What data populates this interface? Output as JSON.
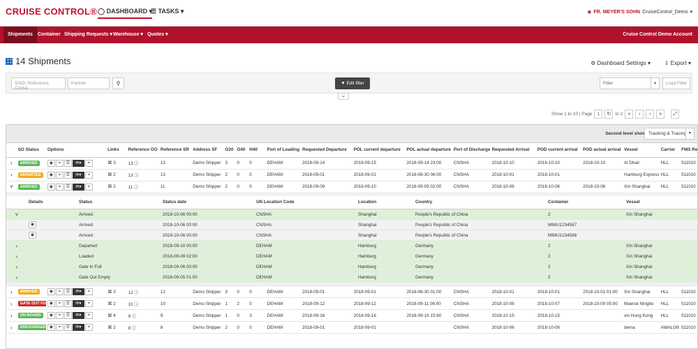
{
  "app": {
    "title": "CRUISE CONTROL®",
    "brand": "FR. MEYER'S SOHN",
    "user": "CruiseControl_Demo",
    "nav_dashboard": "DASHBOARD",
    "nav_tasks": "TASKS"
  },
  "menu": {
    "items": [
      "Shipments",
      "Container",
      "Shipping Requests",
      "Warehouse",
      "Quotes"
    ],
    "account": "Cruise Control Demo Account"
  },
  "page": {
    "title": "14 Shipments",
    "settings": "Dashboard Settings",
    "export": "Export"
  },
  "filters": {
    "search_placeholder": "SSID, Reference, Contai",
    "partner_placeholder": "Partner",
    "edit_filter": "Edit filter",
    "filter_select": "Filter",
    "load_filter": "Load Filter"
  },
  "pager": {
    "text": "Show 1 to 10 | Page",
    "page": "1",
    "to": "to 2"
  },
  "second_level": {
    "label": "Second level shows",
    "value": "Tracking & Tracing"
  },
  "table": {
    "columns": [
      "",
      "SO Status",
      "Options",
      "Links",
      "Reference OO",
      "Reference SR",
      "Address SF",
      "O20",
      "O40",
      "H40",
      "Port of Loading",
      "Requested Departure",
      "POL current departure",
      "POL actual departure",
      "Port of Discharge",
      "Requested Arrival",
      "POD current arrival",
      "POD actual arrival",
      "Vessel",
      "Carrier",
      "FMS Ref"
    ],
    "rows": [
      {
        "expander": ">",
        "status": "ARRIVED",
        "color": "#5cb85c",
        "links": "3",
        "ref_oo": "13",
        "ref_sr": "13",
        "addr": "Demo Shipper",
        "o20": "3",
        "o40": "0",
        "h40": "0",
        "pol": "DEHAM",
        "req_dep": "2018-09-14",
        "pol_cur": "2018-09-15",
        "pol_act": "2018-09-14 23:00",
        "pod": "CNSHA",
        "req_arr": "2018-10-10",
        "pod_cur": "2018-10-10",
        "pod_act": "2018-10-10",
        "vessel": "Al Dhail",
        "carrier": "HLL",
        "fms": "511010"
      },
      {
        "expander": ">",
        "status": "DEPARTED",
        "color": "#f0ad1e",
        "links": "2",
        "ref_oo": "13",
        "ref_sr": "13",
        "addr": "Demo Shipper",
        "o20": "2",
        "o40": "0",
        "h40": "0",
        "pol": "DEHAM",
        "req_dep": "2018-09-01",
        "pol_cur": "2018-09-01",
        "pol_act": "2018-08-30 06:00",
        "pod": "CNSHA",
        "req_arr": "2018-10-01",
        "pod_cur": "2018-10-01",
        "pod_act": "",
        "vessel": "Hamburg Express",
        "carrier": "HLL",
        "fms": "511010"
      },
      {
        "expander": "v",
        "status": "ARRIVED",
        "color": "#5cb85c",
        "links": "2",
        "ref_oo": "11",
        "ref_sr": "11",
        "addr": "Demo Shipper",
        "o20": "2",
        "o40": "0",
        "h40": "0",
        "pol": "DEHAM",
        "req_dep": "2018-09-09",
        "pol_cur": "2018-09-10",
        "pol_act": "2018-09-09 02:00",
        "pod": "CNSHA",
        "req_arr": "2018-10-06",
        "pod_cur": "2018-10-06",
        "pod_act": "2018-10-06",
        "vessel": "Xin Shanghai",
        "carrier": "HLL",
        "fms": "511010"
      }
    ],
    "rows_after": [
      {
        "expander": ">",
        "status": "ARRIVED",
        "color": "#f0ad1e",
        "links": "3",
        "ref_oo": "12",
        "ref_sr": "12",
        "addr": "Demo Shipper",
        "o20": "3",
        "o40": "0",
        "h40": "0",
        "pol": "DEHAM",
        "req_dep": "2018-09-01",
        "pol_cur": "2018-09-01",
        "pol_act": "2018-08-30 01:00",
        "pod": "CNSHA",
        "req_arr": "2018-10-01",
        "pod_cur": "2018-10-01",
        "pod_act": "2018-10-01 01:00",
        "vessel": "Xin Shanghai",
        "carrier": "HLL",
        "fms": "511010"
      },
      {
        "expander": ">",
        "status": "GATE OUT FULL",
        "color": "#c9302c",
        "links": "2",
        "ref_oo": "10",
        "ref_sr": "10",
        "addr": "Demo Shipper",
        "o20": "1",
        "o40": "2",
        "h40": "0",
        "pol": "DEHAM",
        "req_dep": "2018-09-12",
        "pol_cur": "2018-09-12",
        "pol_act": "2018-09-11 06:00",
        "pod": "CNSHA",
        "req_arr": "2018-10-08",
        "pod_cur": "2018-10-07",
        "pod_act": "2018-10-09 05:00",
        "vessel": "Maersk Ningbo",
        "carrier": "HLL",
        "fms": "511010"
      },
      {
        "expander": ">",
        "status": "ON BOARD",
        "color": "#5cb85c",
        "links": "4",
        "ref_oo": "9",
        "ref_sr": "9",
        "addr": "Demo Shipper",
        "o20": "1",
        "o40": "0",
        "h40": "3",
        "pol": "DEHAM",
        "req_dep": "2018-09-16",
        "pol_cur": "2018-09-16",
        "pol_act": "2018-09-16 15:60",
        "pod": "CNSHA",
        "req_arr": "2018-10-15",
        "pod_cur": "2018-10-15",
        "pod_act": "",
        "vessel": "xin Hong Kong",
        "carrier": "HLL",
        "fms": "511010"
      },
      {
        "expander": ">",
        "status": "DISCHARGED",
        "color": "#5cb85c",
        "links": "2",
        "ref_oo": "8",
        "ref_sr": "8",
        "addr": "Demo Shipper",
        "o20": "2",
        "o40": "0",
        "h40": "0",
        "pol": "DEHAM",
        "req_dep": "2018-09-01",
        "pol_cur": "2018-09-01",
        "pol_act": "",
        "pod": "CNSHA",
        "req_arr": "2018-10-06",
        "pod_cur": "2018-10-06",
        "pod_act": "",
        "vessel": "dema",
        "carrier": "AWALGB",
        "fms": "511010"
      }
    ]
  },
  "sub_table": {
    "columns": [
      "",
      "Details",
      "Status",
      "Status date",
      "UN Location Code",
      "Location",
      "Country",
      "Container",
      "Vessel"
    ],
    "rows": [
      {
        "exp": "v",
        "eye": false,
        "status": "Arrived",
        "date": "2018-10-06 00:00",
        "code": "CNSHA",
        "loc": "Shanghai",
        "country": "People's Republic of China",
        "cont": "2",
        "vessel": "Xin Shanghai",
        "green": true
      },
      {
        "exp": "",
        "eye": true,
        "status": "Arrived",
        "date": "2018-10-06 00:00",
        "code": "CNSHA",
        "loc": "Shanghai",
        "country": "People's Republic of China",
        "cont": "MIMU1234567",
        "vessel": "",
        "green": false
      },
      {
        "exp": "",
        "eye": true,
        "status": "Arrived",
        "date": "2018-10-06 00:00",
        "code": "CNSHA",
        "loc": "Shanghai",
        "country": "People's Republic of China",
        "cont": "MIMU1234566",
        "vessel": "",
        "green": false
      },
      {
        "exp": ">",
        "eye": false,
        "status": "Departed",
        "date": "2018-09-10 00:00",
        "code": "DEHAM",
        "loc": "Hamburg",
        "country": "Germany",
        "cont": "2",
        "vessel": "Xin Shanghai",
        "green": true
      },
      {
        "exp": ">",
        "eye": false,
        "status": "Loaded",
        "date": "2018-09-09 02:00",
        "code": "DEHAM",
        "loc": "Hamburg",
        "country": "Germany",
        "cont": "2",
        "vessel": "Xin Shanghai",
        "green": true
      },
      {
        "exp": ">",
        "eye": false,
        "status": "Gate In Full",
        "date": "2018-09-06 00:00",
        "code": "DEHAM",
        "loc": "Hamburg",
        "country": "Germany",
        "cont": "2",
        "vessel": "Xin Shanghai",
        "green": true
      },
      {
        "exp": ">",
        "eye": false,
        "status": "Gate Out Empty",
        "date": "2018-09-05 01:00",
        "code": "DEHAM",
        "loc": "Hamburg",
        "country": "Germany",
        "cont": "2",
        "vessel": "Xin Shanghai",
        "green": true
      }
    ]
  }
}
